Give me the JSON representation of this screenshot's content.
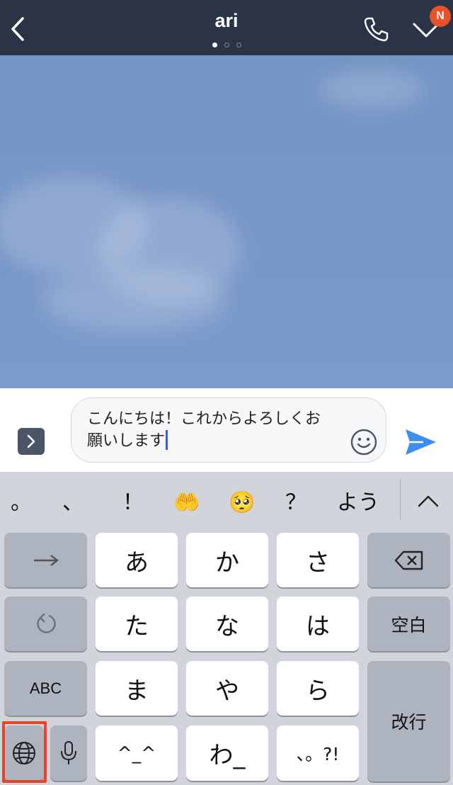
{
  "header": {
    "title": "ari",
    "badge": "N",
    "page_dots": 3,
    "active_dot": 0
  },
  "input": {
    "message_text": "こんにちは！これからよろしくお願いします",
    "expand_icon": "chevron-right-icon",
    "emoji_icon": "smiley-icon",
    "send_icon": "paper-plane-icon"
  },
  "keyboard": {
    "candidates": [
      "。",
      "、",
      "！",
      "🤲",
      "🥺",
      "？",
      "よう"
    ],
    "keys": {
      "a": "あ",
      "ka": "か",
      "sa": "さ",
      "ta": "た",
      "na": "な",
      "ha": "は",
      "ma": "ま",
      "ya": "や",
      "ra": "ら",
      "emoticon": "^_^",
      "wa": "わ_",
      "punct": "、。?!",
      "abc": "ABC",
      "space": "空白",
      "enter": "改行"
    }
  },
  "colors": {
    "header_bg": "#2b3446",
    "chat_bg": "#7796c7",
    "send": "#3e8ef0",
    "badge": "#e8522b",
    "highlight": "#e5462a"
  }
}
